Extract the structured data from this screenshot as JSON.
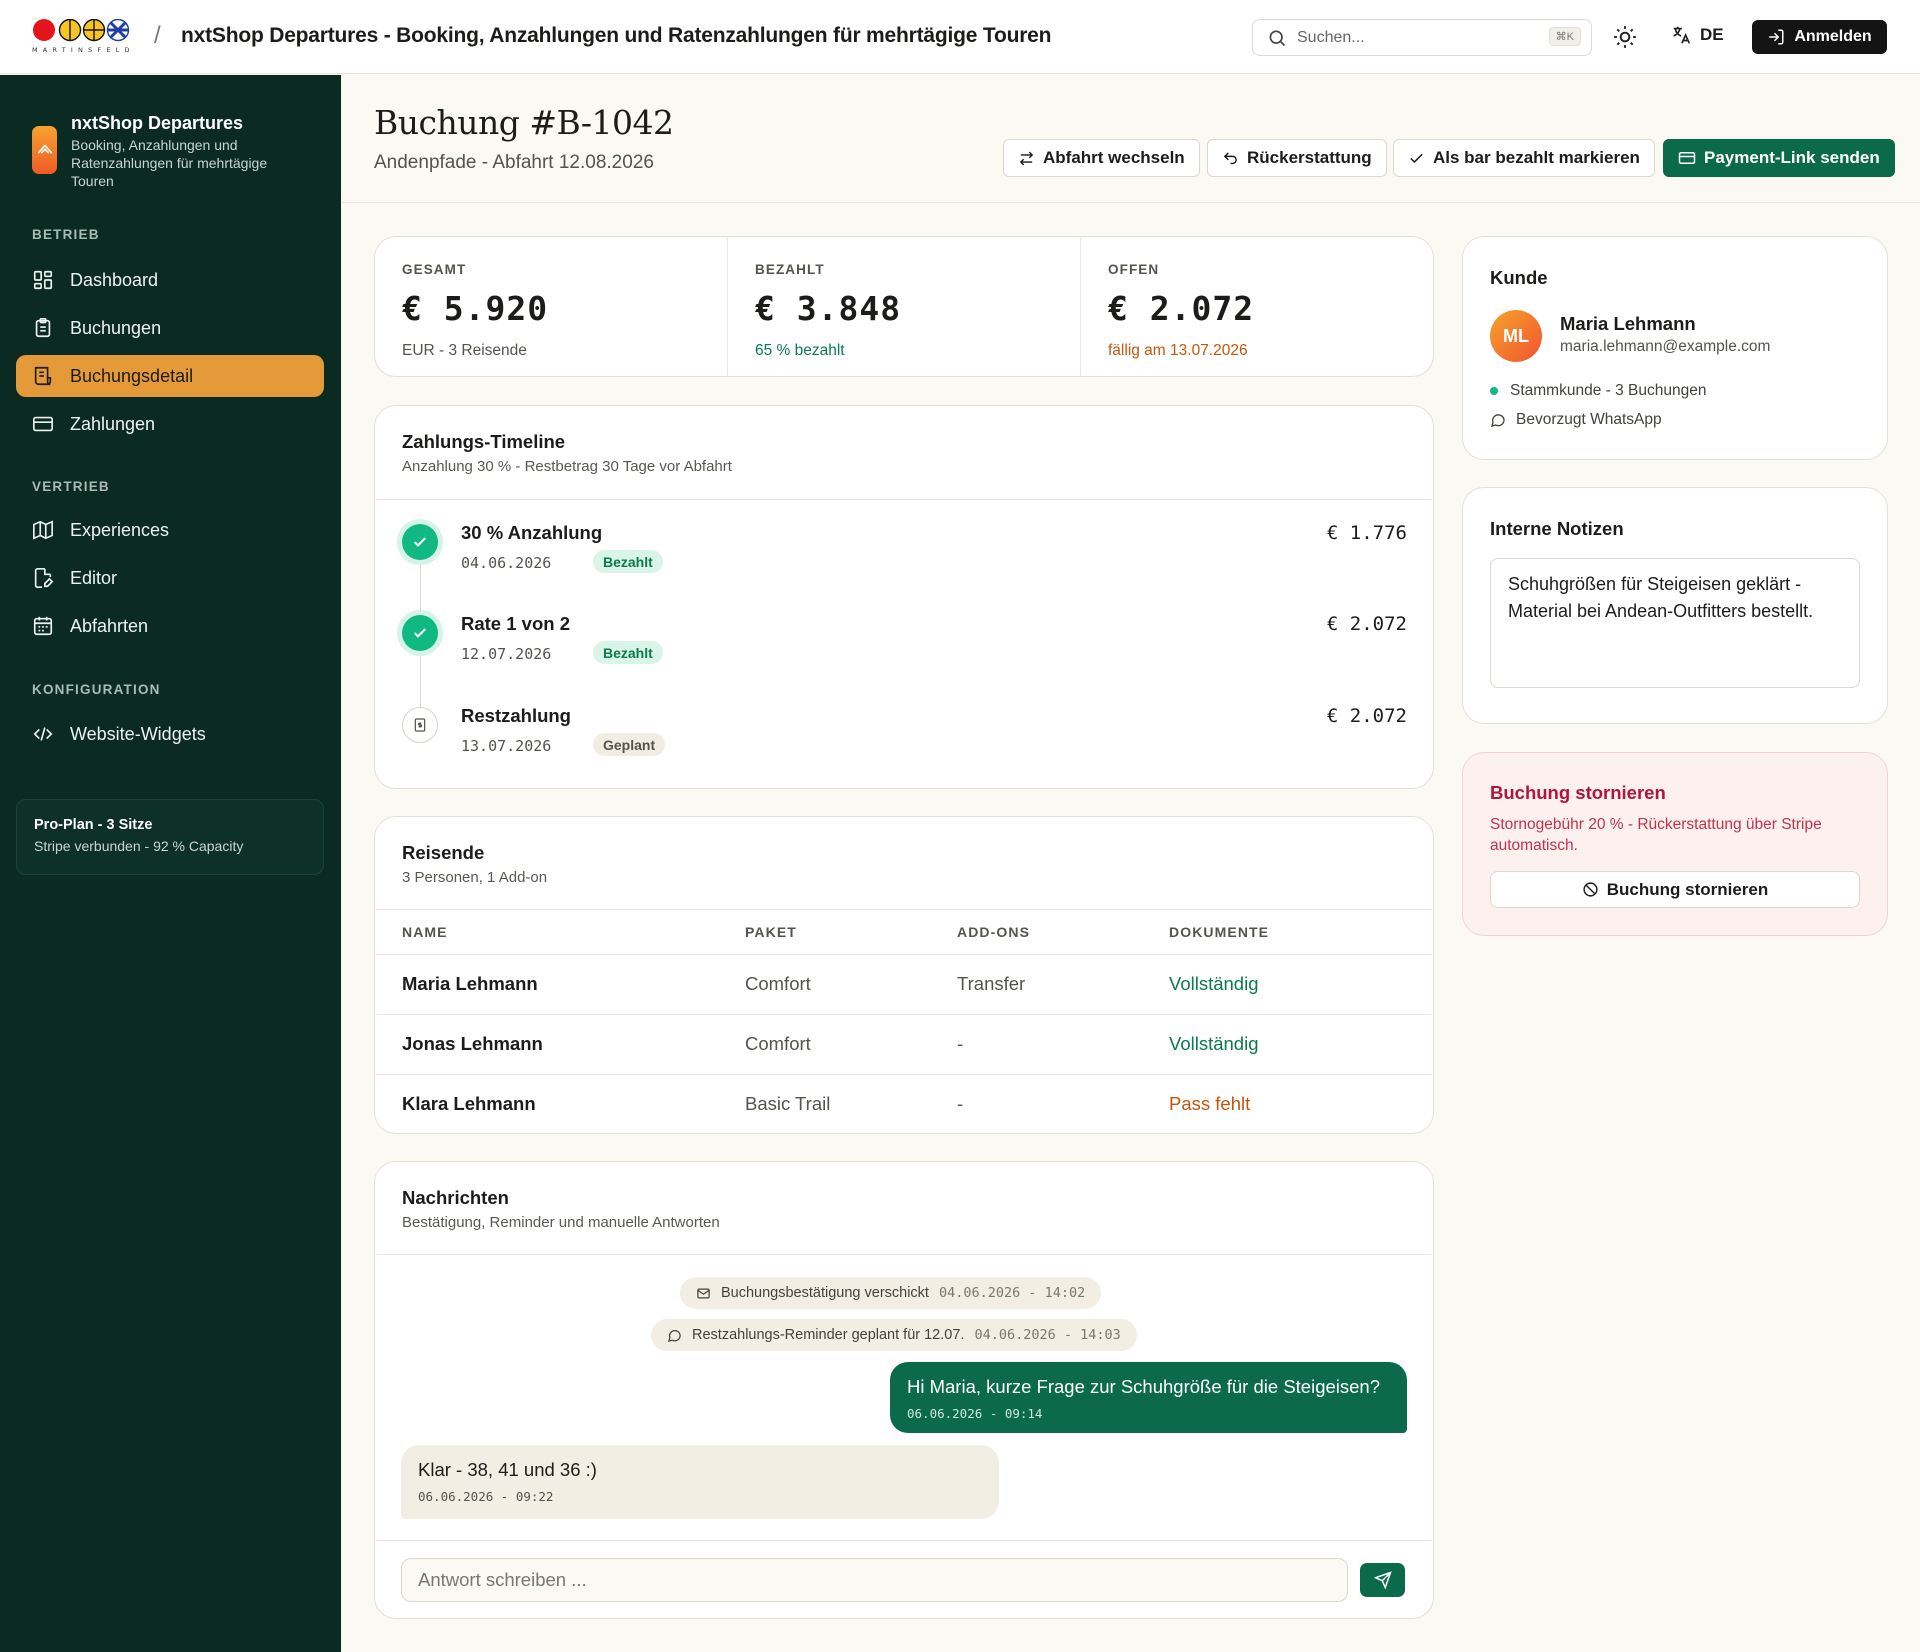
{
  "topbar": {
    "logo_text": "MARTINSFELD",
    "separator": "/",
    "title": "nxtShop Departures - Booking, Anzahlungen und Ratenzahlungen für mehrtägige Touren",
    "search_placeholder": "Suchen...",
    "search_shortcut": "⌘K",
    "language": "DE",
    "login_label": "Anmelden"
  },
  "sidebar": {
    "brand_title": "nxtShop Departures",
    "brand_subtitle": "Booking, Anzahlungen und Ratenzahlungen für mehrtägige Touren",
    "sections": [
      {
        "label": "BETRIEB",
        "items": [
          {
            "label": "Dashboard",
            "icon": "dashboard-icon"
          },
          {
            "label": "Buchungen",
            "icon": "clipboard-icon"
          },
          {
            "label": "Buchungsdetail",
            "icon": "receipt-icon",
            "active": true
          },
          {
            "label": "Zahlungen",
            "icon": "credit-card-icon"
          }
        ]
      },
      {
        "label": "VERTRIEB",
        "items": [
          {
            "label": "Experiences",
            "icon": "map-icon"
          },
          {
            "label": "Editor",
            "icon": "file-edit-icon"
          },
          {
            "label": "Abfahrten",
            "icon": "calendar-icon"
          }
        ]
      },
      {
        "label": "KONFIGURATION",
        "items": [
          {
            "label": "Website-Widgets",
            "icon": "code-icon"
          }
        ]
      }
    ],
    "plan_title": "Pro-Plan - 3 Sitze",
    "plan_subtitle": "Stripe verbunden - 92 % Capacity"
  },
  "header": {
    "title": "Buchung #B-1042",
    "subtitle": "Andenpfade - Abfahrt 12.08.2026",
    "buttons": {
      "switch": "Abfahrt wechseln",
      "refund": "Rückerstattung",
      "mark_cash": "Als bar bezahlt markieren",
      "payment_link": "Payment-Link senden"
    }
  },
  "stats": {
    "total_label": "GESAMT",
    "total_value": "€ 5.920",
    "total_note": "EUR - 3 Reisende",
    "paid_label": "BEZAHLT",
    "paid_value": "€ 3.848",
    "paid_note": "65 % bezahlt",
    "open_label": "OFFEN",
    "open_value": "€ 2.072",
    "open_note": "fällig am 13.07.2026"
  },
  "timeline": {
    "title": "Zahlungs-Timeline",
    "subtitle": "Anzahlung 30 % - Restbetrag 30 Tage vor Abfahrt",
    "items": [
      {
        "name": "30 % Anzahlung",
        "date": "04.06.2026",
        "status": "Bezahlt",
        "amount": "€ 1.776"
      },
      {
        "name": "Rate 1 von 2",
        "date": "12.07.2026",
        "status": "Bezahlt",
        "amount": "€ 2.072"
      },
      {
        "name": "Restzahlung",
        "date": "13.07.2026",
        "status": "Geplant",
        "amount": "€ 2.072"
      }
    ]
  },
  "travelers": {
    "title": "Reisende",
    "subtitle": "3 Personen, 1 Add-on",
    "columns": [
      "NAME",
      "PAKET",
      "ADD-ONS",
      "DOKUMENTE"
    ],
    "rows": [
      {
        "name": "Maria Lehmann",
        "package": "Comfort",
        "addons": "Transfer",
        "docs": "Vollständig"
      },
      {
        "name": "Jonas Lehmann",
        "package": "Comfort",
        "addons": "-",
        "docs": "Vollständig"
      },
      {
        "name": "Klara Lehmann",
        "package": "Basic Trail",
        "addons": "-",
        "docs": "Pass fehlt"
      }
    ]
  },
  "messages": {
    "title": "Nachrichten",
    "subtitle": "Bestätigung, Reminder und manuelle Antworten",
    "events": [
      {
        "text": "Buchungsbestätigung verschickt",
        "time": "04.06.2026 - 14:02"
      },
      {
        "text": "Restzahlungs-Reminder geplant für 12.07.",
        "time": "04.06.2026 - 14:03"
      }
    ],
    "outgoing": {
      "text": "Hi Maria, kurze Frage zur Schuhgröße für die Steigeisen?",
      "time": "06.06.2026 - 09:14"
    },
    "incoming": {
      "text": "Klar - 38, 41 und 36 :)",
      "time": "06.06.2026 - 09:22"
    },
    "reply_placeholder": "Antwort schreiben ..."
  },
  "customer": {
    "title": "Kunde",
    "initials": "ML",
    "name": "Maria Lehmann",
    "email": "maria.lehmann@example.com",
    "status": "Stammkunde - 3 Buchungen",
    "channel": "Bevorzugt WhatsApp"
  },
  "notes": {
    "title": "Interne Notizen",
    "text": "Schuhgrößen für Steigeisen geklärt - Material bei Andean-Outfitters bestellt."
  },
  "cancel": {
    "title": "Buchung stornieren",
    "text": "Stornogebühr 20 % - Rückerstattung über Stripe automatisch.",
    "button": "Buchung stornieren"
  },
  "colors": {
    "sidebar_bg": "#0b2b22",
    "accent_active": "#e59a3a",
    "primary_green": "#0b6a4a",
    "success_green": "#10b981",
    "warning_orange": "#c2560c",
    "danger_red": "#b0143f"
  }
}
